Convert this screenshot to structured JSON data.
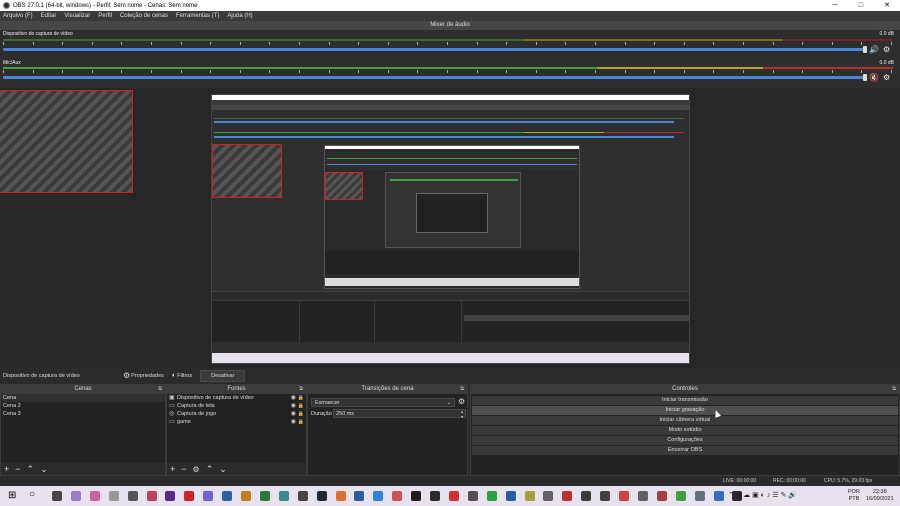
{
  "window": {
    "title": "OBS 27.0.1 (64-bit, windows) - Perfil: Sem nome - Cenas: Sem nome",
    "minimize": "─",
    "maximize": "□",
    "close": "✕"
  },
  "menu": [
    "Arquivo (F)",
    "Editar",
    "Visualizar",
    "Perfil",
    "Coleção de cenas",
    "Ferramentas (T)",
    "Ajuda (H)"
  ],
  "mixer": {
    "title": "Mixer de áudio",
    "tracks": [
      {
        "name": "Dispositivo de captura de vídeo",
        "db": "0.0 dB",
        "muted": false,
        "volume": 0.97
      },
      {
        "name": "Mic/Aux",
        "db": "0.0 dB",
        "muted": true,
        "volume": 0.97
      }
    ]
  },
  "scene_info": {
    "source_name": "Dispositivo de captura de vídeo",
    "properties": "Propriedades",
    "filters": "Filtros",
    "deactivate": "Desativar"
  },
  "scenes": {
    "title": "Cenas",
    "items": [
      "Cena",
      "Cena 2",
      "Cena 3"
    ],
    "selected": 0
  },
  "sources": {
    "title": "Fontes",
    "items": [
      {
        "name": "Dispositivo de captura de vídeo",
        "icon": "camera-icon"
      },
      {
        "name": "Captura de tela",
        "icon": "monitor-icon"
      },
      {
        "name": "Captura de jogo",
        "icon": "gamepad-icon"
      },
      {
        "name": "game",
        "icon": "monitor-icon"
      }
    ]
  },
  "transitions": {
    "title": "Transições de cena",
    "selected": "Esmaecer",
    "duration_label": "Duração",
    "duration_value": "250 ms"
  },
  "controls": {
    "title": "Controles",
    "buttons": [
      "Iniciar transmissão",
      "Iniciar gravação",
      "Iniciar câmera virtual",
      "Modo estúdio",
      "Configurações",
      "Encerrar OBS"
    ],
    "hovered": 1
  },
  "status": {
    "live": "LIVE: 00:00:00",
    "rec": "REC: 00:00:00",
    "cpu": "CPU: 5.7%, 29.03 fps"
  },
  "taskbar": {
    "lang": "POR",
    "lang2": "PTB",
    "time": "22:38",
    "date": "16/09/2021"
  },
  "colors": {
    "meter_green": "#3fa33a",
    "meter_yellow": "#b7a626",
    "meter_red": "#b03030",
    "fader_blue": "#4a86d6",
    "selection_border": "#d02020"
  }
}
